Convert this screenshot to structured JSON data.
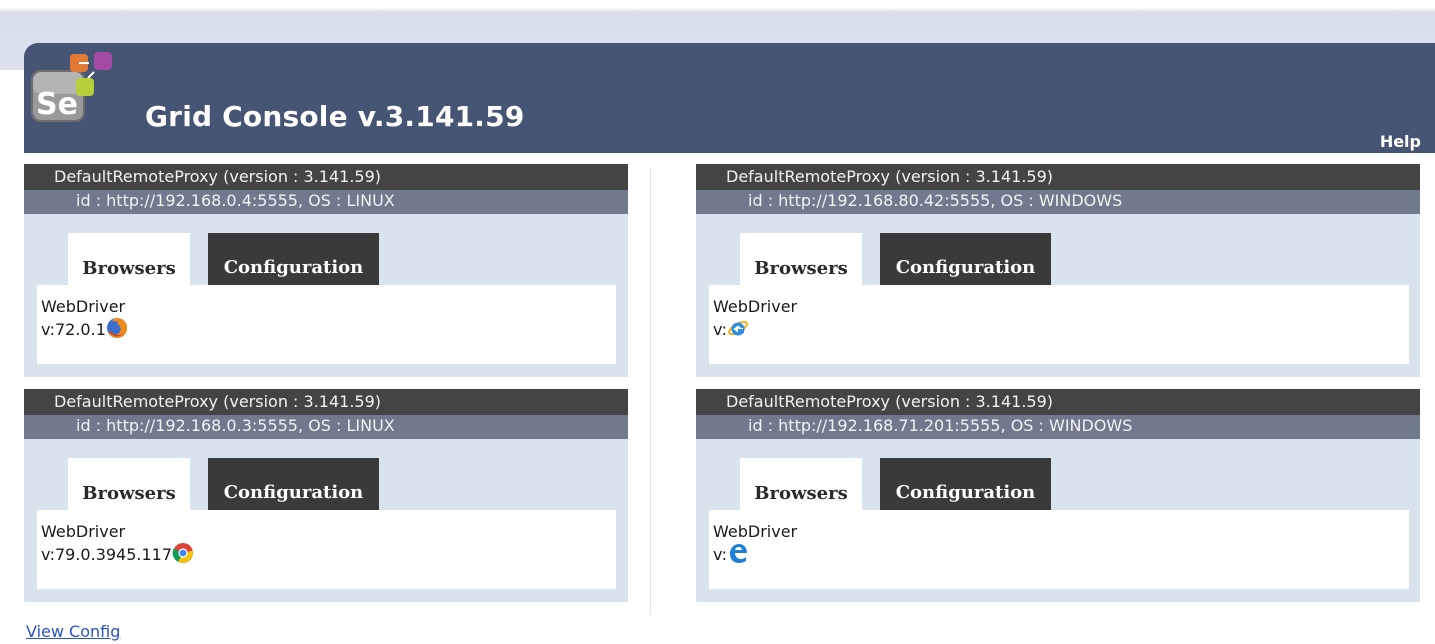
{
  "header": {
    "title": "Grid Console v.3.141.59",
    "help_label": "Help",
    "logo_text": "Se"
  },
  "proxies": [
    {
      "title": "DefaultRemoteProxy (version : 3.141.59)",
      "id_line": "id : http://192.168.0.4:5555, OS : LINUX",
      "tabs": {
        "browsers": "Browsers",
        "configuration": "Configuration"
      },
      "driver": "WebDriver",
      "version": "v:72.0.1",
      "browser_icon": "firefox-icon"
    },
    {
      "title": "DefaultRemoteProxy (version : 3.141.59)",
      "id_line": "id : http://192.168.80.42:5555, OS : WINDOWS",
      "tabs": {
        "browsers": "Browsers",
        "configuration": "Configuration"
      },
      "driver": "WebDriver",
      "version": "v:",
      "browser_icon": "internet-explorer-icon"
    },
    {
      "title": "DefaultRemoteProxy (version : 3.141.59)",
      "id_line": "id : http://192.168.0.3:5555, OS : LINUX",
      "tabs": {
        "browsers": "Browsers",
        "configuration": "Configuration"
      },
      "driver": "WebDriver",
      "version": "v:79.0.3945.117",
      "browser_icon": "chrome-icon"
    },
    {
      "title": "DefaultRemoteProxy (version : 3.141.59)",
      "id_line": "id : http://192.168.71.201:5555, OS : WINDOWS",
      "tabs": {
        "browsers": "Browsers",
        "configuration": "Configuration"
      },
      "driver": "WebDriver",
      "version": "v:",
      "browser_icon": "edge-icon"
    }
  ],
  "footer": {
    "view_config_label": "View Config"
  },
  "colors": {
    "header_bg": "#465573",
    "proxy_title_bg": "#444444",
    "proxy_id_bg": "#707a8c",
    "panel_bg": "#d9e3ed",
    "link": "#2a53c6"
  }
}
